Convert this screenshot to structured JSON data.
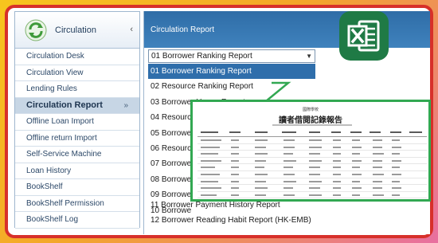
{
  "sidebar": {
    "title": "Circulation",
    "items": [
      {
        "label": "Circulation Desk"
      },
      {
        "label": "Circulation View"
      },
      {
        "label": "Lending Rules"
      },
      {
        "label": "Circulation Report",
        "arrow": "»"
      },
      {
        "label": "Offline Loan Import"
      },
      {
        "label": "Offline return Import"
      },
      {
        "label": "Self-Service Machine"
      },
      {
        "label": "Loan History"
      },
      {
        "label": "BookShelf"
      },
      {
        "label": "BookShelf Permission"
      },
      {
        "label": "BookShelf Log"
      }
    ]
  },
  "main": {
    "title": "Circulation Report",
    "select_value": "01 Borrower Ranking Report",
    "options": [
      "01 Borrower Ranking Report",
      "02 Resource Ranking Report",
      "03 Borrower Usage Report",
      "04 Resource",
      "05 Borrowe",
      "06 Resourc",
      "07 Borrowe",
      "08 Borrowe",
      "09 Borrowe",
      "10 Borrowe",
      "11 Borrower Payment History Report",
      "12 Borrower Reading Habit Report (HK-EMB)"
    ]
  },
  "preview": {
    "subtitle": "國際學校",
    "title": "讀者借閱記錄報告"
  },
  "excel_icon": "excel-icon",
  "colors": {
    "frame": "#d7302a",
    "preview_border": "#32a852",
    "excel": "#1f7a45",
    "selected": "#2f6eab"
  }
}
